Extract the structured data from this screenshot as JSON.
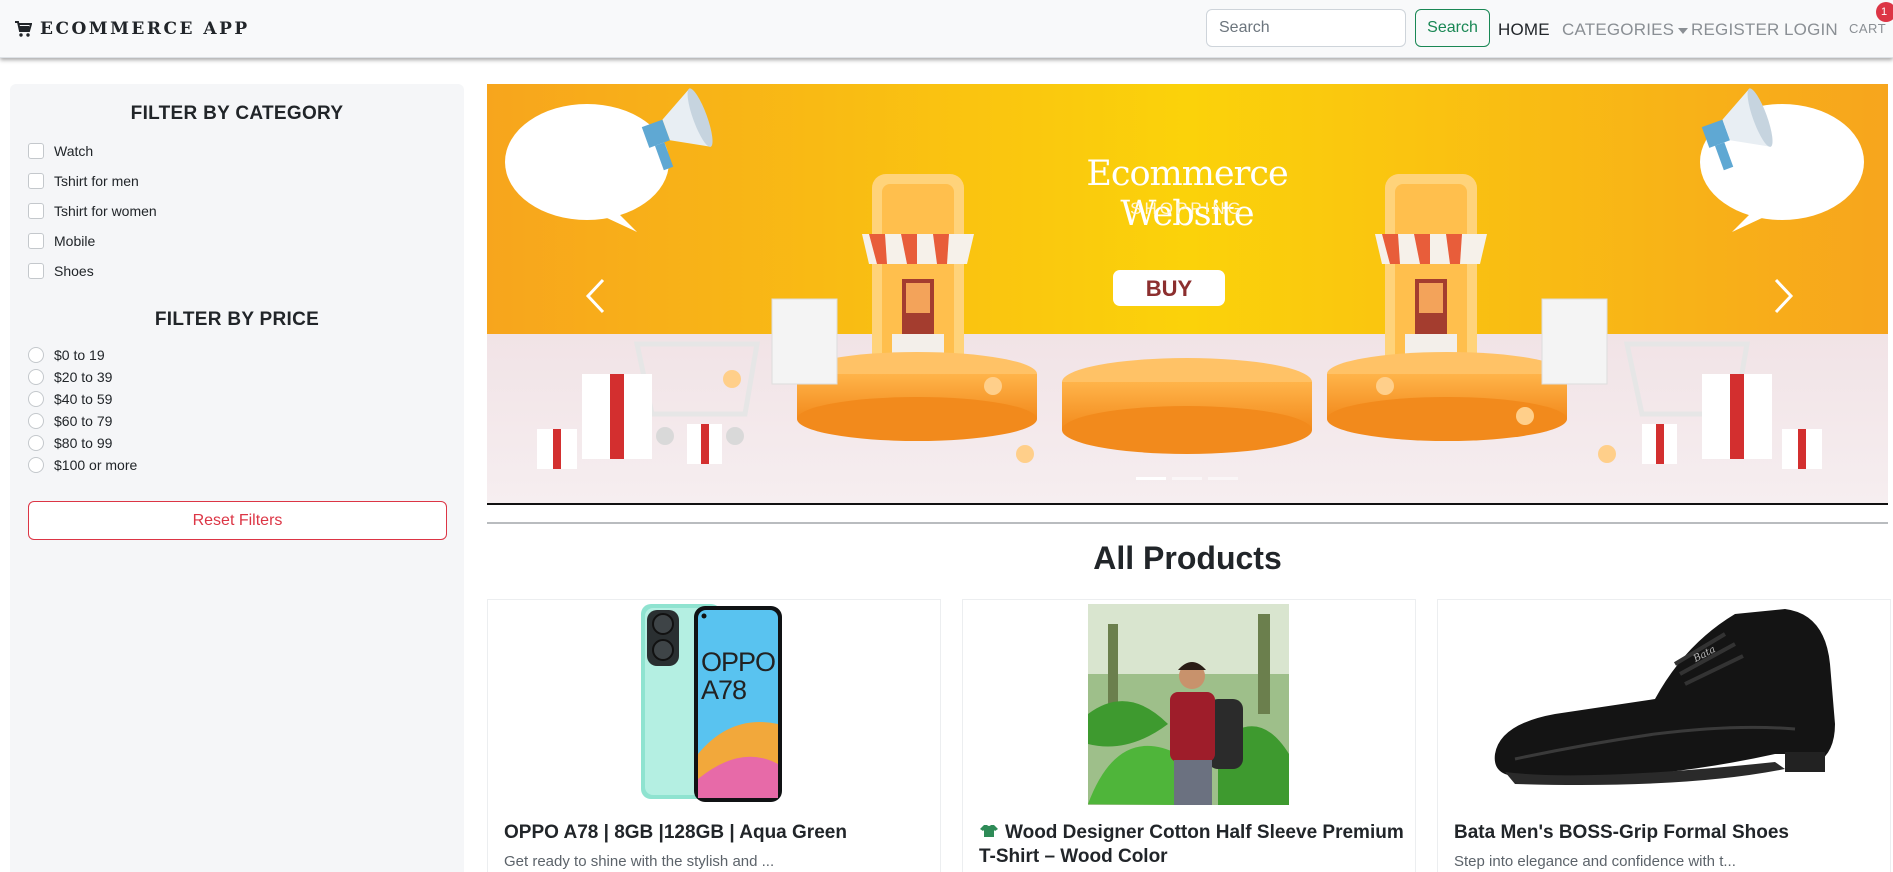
{
  "navbar": {
    "brand": "ECOMMERCE APP",
    "search_placeholder": "Search",
    "search_button": "Search",
    "links": {
      "home": "HOME",
      "categories": "CATEGORIES",
      "register": "REGISTER",
      "login": "LOGIN",
      "cart": "CART"
    },
    "cart_count": "1",
    "icons": {
      "brand": "cart-icon",
      "categories": "chevron-down-icon"
    }
  },
  "sidebar": {
    "category_title": "FILTER BY CATEGORY",
    "categories": [
      {
        "label": "Watch",
        "checked": false
      },
      {
        "label": "Tshirt for men",
        "checked": false
      },
      {
        "label": "Tshirt for women",
        "checked": false
      },
      {
        "label": "Mobile",
        "checked": false
      },
      {
        "label": "Shoes",
        "checked": false
      }
    ],
    "price_title": "FILTER BY PRICE",
    "prices": [
      {
        "label": "$0 to 19",
        "selected": false
      },
      {
        "label": "$20 to 39",
        "selected": false
      },
      {
        "label": "$40 to 59",
        "selected": false
      },
      {
        "label": "$60 to 79",
        "selected": false
      },
      {
        "label": "$80 to 99",
        "selected": false
      },
      {
        "label": "$100 or more",
        "selected": false
      }
    ],
    "reset_button": "Reset Filters"
  },
  "carousel": {
    "slide_title": "Ecommerce Website",
    "slide_subtitle": "SHOPPING",
    "slide_button": "BUY",
    "slide_count": 3,
    "active_slide": 1,
    "icons": {
      "prev": "chevron-left-icon",
      "next": "chevron-right-icon"
    }
  },
  "products_heading": "All Products",
  "products": [
    {
      "title": "OPPO A78 | 8GB |128GB | Aqua Green",
      "description": "Get ready to shine with the stylish and ...",
      "image_label": "OPPO A78"
    },
    {
      "title": "Wood Designer Cotton Half Sleeve Premium T-Shirt – Wood Color",
      "description": "",
      "icon": "tshirt-icon"
    },
    {
      "title": "Bata Men's BOSS-Grip Formal Shoes",
      "description": "Step into elegance and confidence with t...",
      "image_label": "Bata"
    }
  ],
  "colors": {
    "search_green": "#198754",
    "reset_red": "#dc3545",
    "banner_orange": "#f9a825",
    "phone_aqua": "#8fe3d0"
  }
}
